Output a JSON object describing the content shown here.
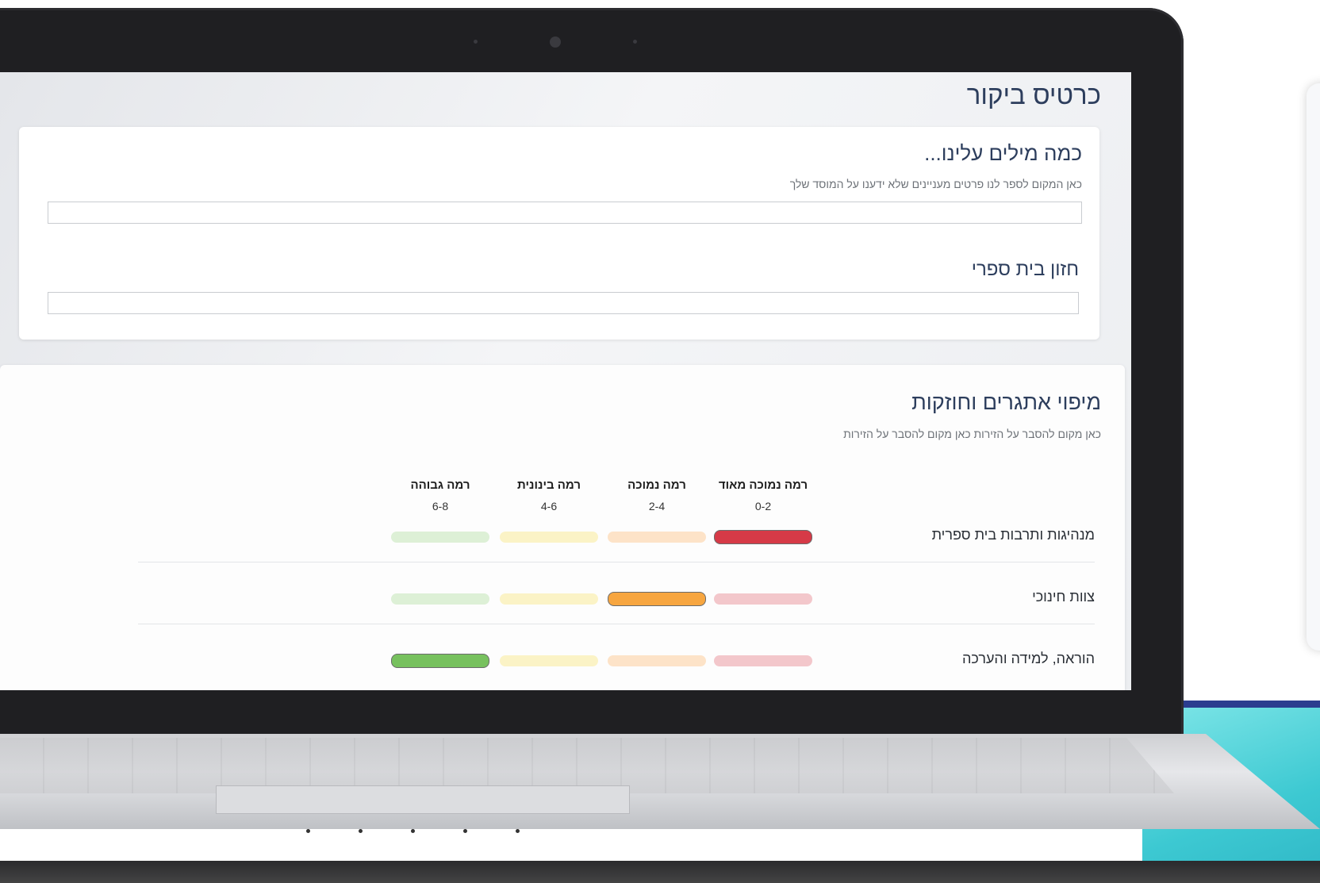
{
  "page": {
    "title": "כרטיס ביקור"
  },
  "about_card": {
    "heading": "כמה מילים עלינו...",
    "help_text": "כאן המקום לספר לנו פרטים מעניינים שלא ידענו על המוסד שלך",
    "about_value": "",
    "vision_heading": "חזון בית ספרי",
    "vision_value": ""
  },
  "mapping_card": {
    "heading": "מיפוי אתגרים וחוזקות",
    "help_text": "כאן מקום להסבר על הזירות כאן מקום להסבר על הזירות",
    "levels": [
      {
        "label": "רמה נמוכה מאוד",
        "range": "0-2",
        "active_color": "#d63a47",
        "muted_color": "#f3c7cb"
      },
      {
        "label": "רמה נמוכה",
        "range": "2-4",
        "active_color": "#f7a640",
        "muted_color": "#fde3c8"
      },
      {
        "label": "רמה בינונית",
        "range": "4-6",
        "active_color": "#f5e27a",
        "muted_color": "#fbf3c6"
      },
      {
        "label": "רמה גבוהה",
        "range": "6-8",
        "active_color": "#77c15e",
        "muted_color": "#ddf0d6"
      }
    ],
    "rows": [
      {
        "label": "מנהיגות ותרבות בית ספרית",
        "selected_level": 0
      },
      {
        "label": "צוות חינוכי",
        "selected_level": 1
      },
      {
        "label": "הוראה, למידה והערכה",
        "selected_level": 3
      }
    ]
  }
}
